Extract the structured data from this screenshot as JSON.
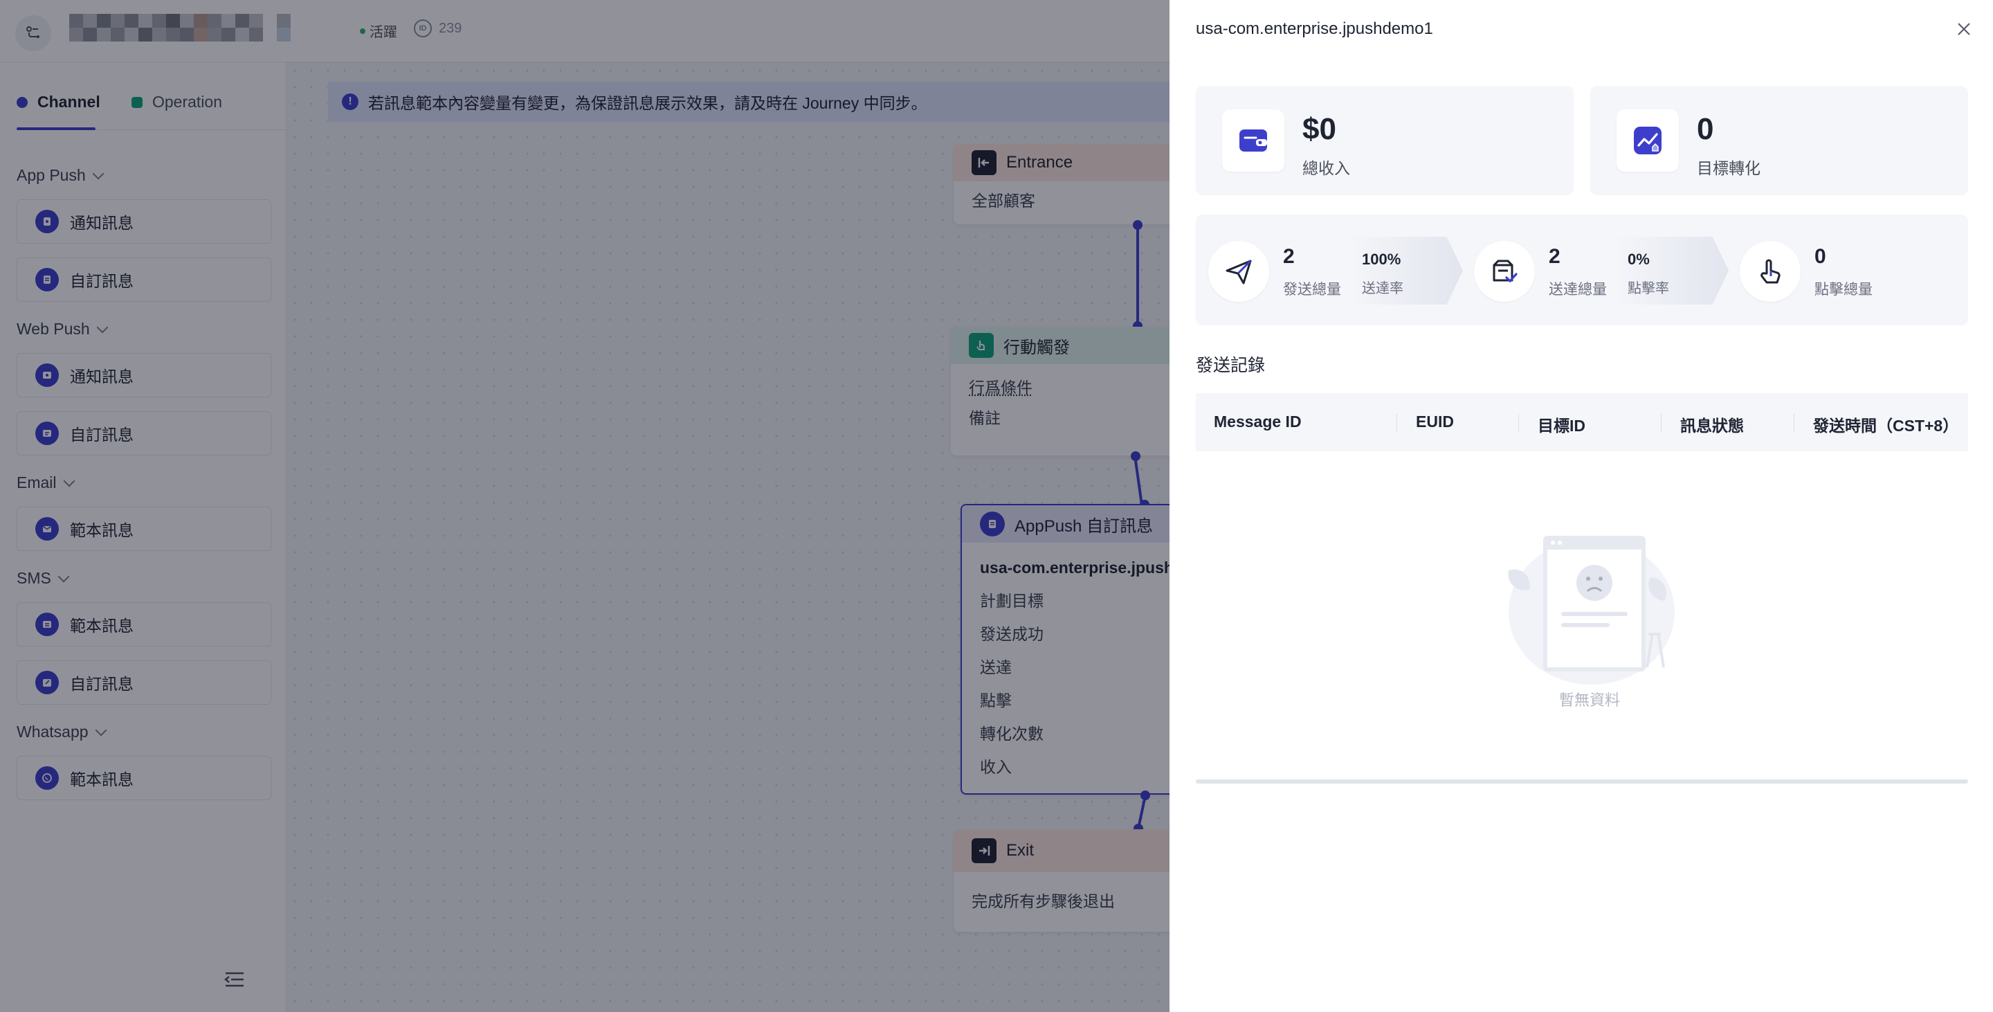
{
  "topbar": {
    "status": "活躍",
    "id_value": "239"
  },
  "sidebar": {
    "tabs": [
      {
        "label": "Channel"
      },
      {
        "label": "Operation"
      }
    ],
    "groups": [
      {
        "title": "App Push",
        "items": [
          {
            "label": "通知訊息",
            "icon": "bell-icon"
          },
          {
            "label": "自訂訊息",
            "icon": "document-icon"
          }
        ]
      },
      {
        "title": "Web Push",
        "items": [
          {
            "label": "通知訊息",
            "icon": "bell-icon"
          },
          {
            "label": "自訂訊息",
            "icon": "message-icon"
          }
        ]
      },
      {
        "title": "Email",
        "items": [
          {
            "label": "範本訊息",
            "icon": "mail-icon"
          }
        ]
      },
      {
        "title": "SMS",
        "items": [
          {
            "label": "範本訊息",
            "icon": "sms-icon"
          },
          {
            "label": "自訂訊息",
            "icon": "edit-icon"
          }
        ]
      },
      {
        "title": "Whatsapp",
        "items": [
          {
            "label": "範本訊息",
            "icon": "whatsapp-icon"
          }
        ]
      }
    ]
  },
  "canvas": {
    "notice": "若訊息範本內容變量有變更，為保證訊息展示效果，請及時在 Journey 中同步。",
    "nodes": {
      "entrance": {
        "title": "Entrance",
        "body": "全部顧客"
      },
      "trigger": {
        "title": "行動觸發",
        "rows": [
          "行爲條件",
          "備註"
        ]
      },
      "apppush": {
        "title": "AppPush 自訂訊息",
        "name": "usa-com.enterprise.jpush",
        "rows": [
          "計劃目標",
          "發送成功",
          "送達",
          "點擊",
          "轉化次數",
          "收入"
        ]
      },
      "exit": {
        "title": "Exit",
        "body": "完成所有步驟後退出"
      }
    }
  },
  "drawer": {
    "title": "usa-com.enterprise.jpushdemo1",
    "kpis": [
      {
        "value": "$0",
        "label": "總收入",
        "icon": "wallet-icon"
      },
      {
        "value": "0",
        "label": "目標轉化",
        "icon": "trend-icon"
      }
    ],
    "funnel": {
      "steps": [
        {
          "value": "2",
          "label": "發送總量",
          "icon": "send-icon"
        },
        {
          "value": "2",
          "label": "送達總量",
          "icon": "delivered-icon"
        },
        {
          "value": "0",
          "label": "點擊總量",
          "icon": "tap-icon"
        }
      ],
      "rates": [
        {
          "value": "100%",
          "label": "送達率"
        },
        {
          "value": "0%",
          "label": "點擊率"
        }
      ]
    },
    "records": {
      "title": "發送記錄",
      "columns": [
        "Message ID",
        "EUID",
        "目標ID",
        "訊息狀態",
        "發送時間（CST+8）"
      ],
      "empty_text": "暫無資料"
    }
  }
}
